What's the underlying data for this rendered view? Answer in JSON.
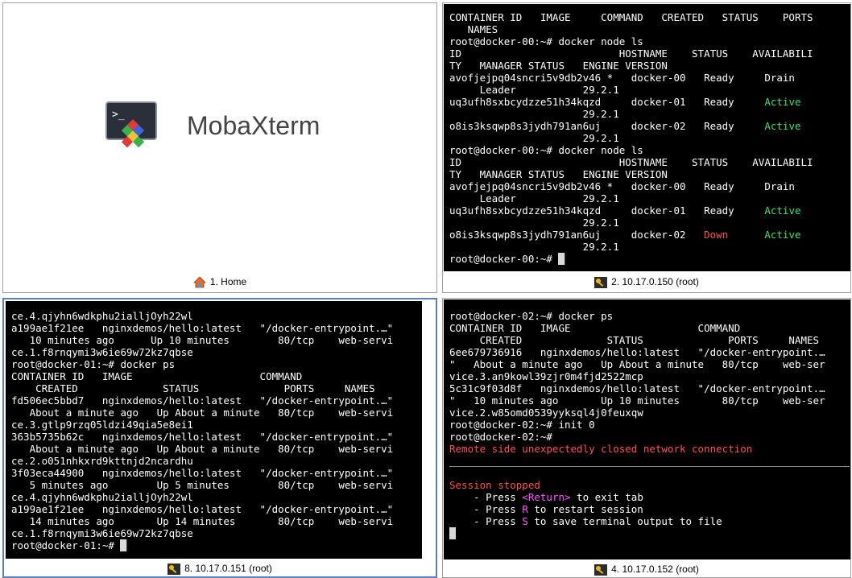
{
  "home": {
    "app_name": "MobaXterm",
    "tab_label": "1. Home"
  },
  "pane2": {
    "tab_label": "2. 10.17.0.150 (root)",
    "lines": [
      "CONTAINER ID   IMAGE     COMMAND   CREATED   STATUS    PORTS",
      "   NAMES",
      "root@docker-00:~# docker node ls",
      "ID                          HOSTNAME    STATUS    AVAILABILI",
      "TY   MANAGER STATUS   ENGINE VERSION",
      "avofjejpq04sncri5v9db2v46 *   docker-00   Ready     Drain",
      "     Leader           29.2.1",
      "uq3ufh8sxbcydzze51h34kqzd     docker-01   Ready     ",
      "                      29.2.1",
      "o8is3ksqwp8s3jydh791an6uj     docker-02   Ready     ",
      "                      29.2.1",
      "root@docker-00:~# docker node ls",
      "ID                          HOSTNAME    STATUS    AVAILABILI",
      "TY   MANAGER STATUS   ENGINE VERSION",
      "avofjejpq04sncri5v9db2v46 *   docker-00   Ready     Drain",
      "     Leader           29.2.1",
      "uq3ufh8sxbcydzze51h34kqzd     docker-01   Ready     ",
      "                      29.2.1",
      "o8is3ksqwp8s3jydh791an6uj     docker-02   ",
      "                      29.2.1",
      "root@docker-00:~# "
    ],
    "active1": "Active",
    "active2": "Active",
    "active3": "Active",
    "active4": "Active",
    "down": "Down",
    "down_pad": "      "
  },
  "pane8": {
    "tab_label": "8. 10.17.0.151 (root)",
    "lines": [
      "ce.4.qjyhn6wdkphu2ialljOyh22wl",
      "a199ae1f21ee   nginxdemos/hello:latest   \"/docker-entrypoint.…\"",
      "   10 minutes ago      Up 10 minutes        80/tcp    web-servi",
      "ce.1.f8rnqymi3w6ie69w72kz7qbse",
      "root@docker-01:~# docker ps",
      "CONTAINER ID   IMAGE                     COMMAND",
      "    CREATED              STATUS              PORTS     NAMES",
      "fd506ec5bbd7   nginxdemos/hello:latest   \"/docker-entrypoint.…\"",
      "   About a minute ago   Up About a minute   80/tcp    web-servi",
      "ce.3.gtlp9rzq05ldzi49qia5e8ei1",
      "363b5735b62c   nginxdemos/hello:latest   \"/docker-entrypoint.…\"",
      "   About a minute ago   Up About a minute   80/tcp    web-servi",
      "ce.2.o051nhkxrd9kttnjd2ncardhu",
      "3f03eca44900   nginxdemos/hello:latest   \"/docker-entrypoint.…\"",
      "   5 minutes ago        Up 5 minutes        80/tcp    web-servi",
      "ce.4.qjyhn6wdkphu2ialljOyh22wl",
      "a199ae1f21ee   nginxdemos/hello:latest   \"/docker-entrypoint.…\"",
      "   14 minutes ago       Up 14 minutes       80/tcp    web-servi",
      "ce.1.f8rnqymi3w6ie69w72kz7qbse",
      "root@docker-01:~# "
    ]
  },
  "pane4": {
    "tab_label": "4. 10.17.0.152 (root)",
    "lines": [
      "root@docker-02:~# docker ps",
      "CONTAINER ID   IMAGE                     COMMAND",
      "     CREATED              STATUS              PORTS     NAMES",
      "6ee679736916   nginxdemos/hello:latest   \"/docker-entrypoint.…",
      "\"   About a minute ago   Up About a minute   80/tcp    web-ser",
      "vice.3.an9kowl39zjr0m4fjd2522mcp",
      "5c31c9f03d8f   nginxdemos/hello:latest   \"/docker-entrypoint.…",
      "\"   10 minutes ago       Up 10 minutes       80/tcp    web-ser",
      "vice.2.w85omd0539yyksql4j0feuxqw",
      "root@docker-02:~# init 0",
      "root@docker-02:~# "
    ],
    "closed_msg": "Remote side unexpectedly closed network connection",
    "session_stopped": "Session stopped",
    "press1_pre": "    - Press ",
    "press1_key": "<Return>",
    "press1_post": " to exit tab",
    "press2_pre": "    - Press ",
    "press2_key": "R",
    "press2_post": " to restart session",
    "press3_pre": "    - Press ",
    "press3_key": "S",
    "press3_post": " to save terminal output to file"
  },
  "colors": {
    "active": "#3ee26a",
    "down": "#ff5050",
    "key": "#ff55ff",
    "selected_border": "#5b7fb8"
  },
  "icons": [
    "home-icon",
    "ssh-key-icon",
    "mobaxterm-logo-icon"
  ]
}
